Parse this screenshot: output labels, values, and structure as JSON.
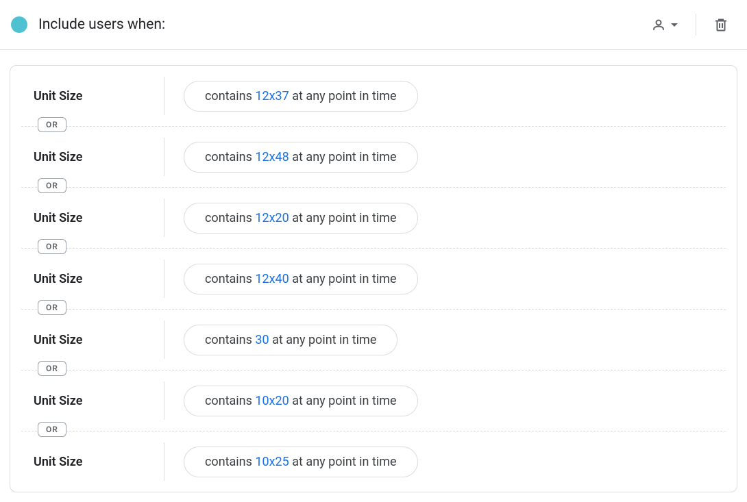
{
  "header": {
    "title": "Include users when:"
  },
  "or_label": "OR",
  "conditions": [
    {
      "dimension": "Unit Size",
      "prefix": "contains ",
      "value": "12x37",
      "suffix": " at any point in time"
    },
    {
      "dimension": "Unit Size",
      "prefix": "contains ",
      "value": "12x48",
      "suffix": " at any point in time"
    },
    {
      "dimension": "Unit Size",
      "prefix": "contains ",
      "value": "12x20",
      "suffix": " at any point in time"
    },
    {
      "dimension": "Unit Size",
      "prefix": "contains ",
      "value": "12x40",
      "suffix": " at any point in time"
    },
    {
      "dimension": "Unit Size",
      "prefix": "contains ",
      "value": "30",
      "suffix": " at any point in time"
    },
    {
      "dimension": "Unit Size",
      "prefix": "contains ",
      "value": "10x20",
      "suffix": " at any point in time"
    },
    {
      "dimension": "Unit Size",
      "prefix": "contains ",
      "value": "10x25",
      "suffix": " at any point in time"
    }
  ],
  "colors": {
    "accent_dot": "#4ec2d1",
    "link": "#1a73e8",
    "border": "#dadce0"
  }
}
